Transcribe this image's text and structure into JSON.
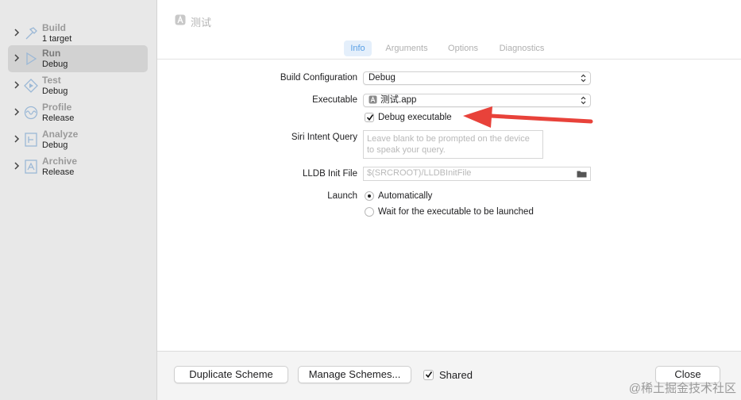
{
  "sidebar": {
    "items": [
      {
        "name": "Build",
        "sub": "1 target",
        "icon": "hammer-icon"
      },
      {
        "name": "Run",
        "sub": "Debug",
        "icon": "play-icon"
      },
      {
        "name": "Test",
        "sub": "Debug",
        "icon": "diamond-play-icon"
      },
      {
        "name": "Profile",
        "sub": "Release",
        "icon": "waveform-icon"
      },
      {
        "name": "Analyze",
        "sub": "Debug",
        "icon": "analyze-icon"
      },
      {
        "name": "Archive",
        "sub": "Release",
        "icon": "archive-icon"
      }
    ]
  },
  "header": {
    "title": "测试",
    "icon": "app-icon"
  },
  "tabs": [
    "Info",
    "Arguments",
    "Options",
    "Diagnostics"
  ],
  "info": {
    "build_config_label": "Build Configuration",
    "build_config_value": "Debug",
    "executable_label": "Executable",
    "executable_value": "测试.app",
    "debug_executable_label": "Debug executable",
    "debug_executable_checked": true,
    "siri_label": "Siri Intent Query",
    "siri_placeholder": "Leave blank to be prompted on the device to speak your query.",
    "lldb_label": "LLDB Init File",
    "lldb_placeholder": "$(SRCROOT)/LLDBInitFile",
    "launch_label": "Launch",
    "launch_options": [
      "Automatically",
      "Wait for the executable to be launched"
    ],
    "launch_selected": "Automatically"
  },
  "footer": {
    "duplicate": "Duplicate Scheme",
    "manage": "Manage Schemes...",
    "shared_label": "Shared",
    "shared_checked": true,
    "close": "Close"
  },
  "annotation": {
    "arrow_color": "#e8423a"
  },
  "watermark": "@稀土掘金技术社区"
}
